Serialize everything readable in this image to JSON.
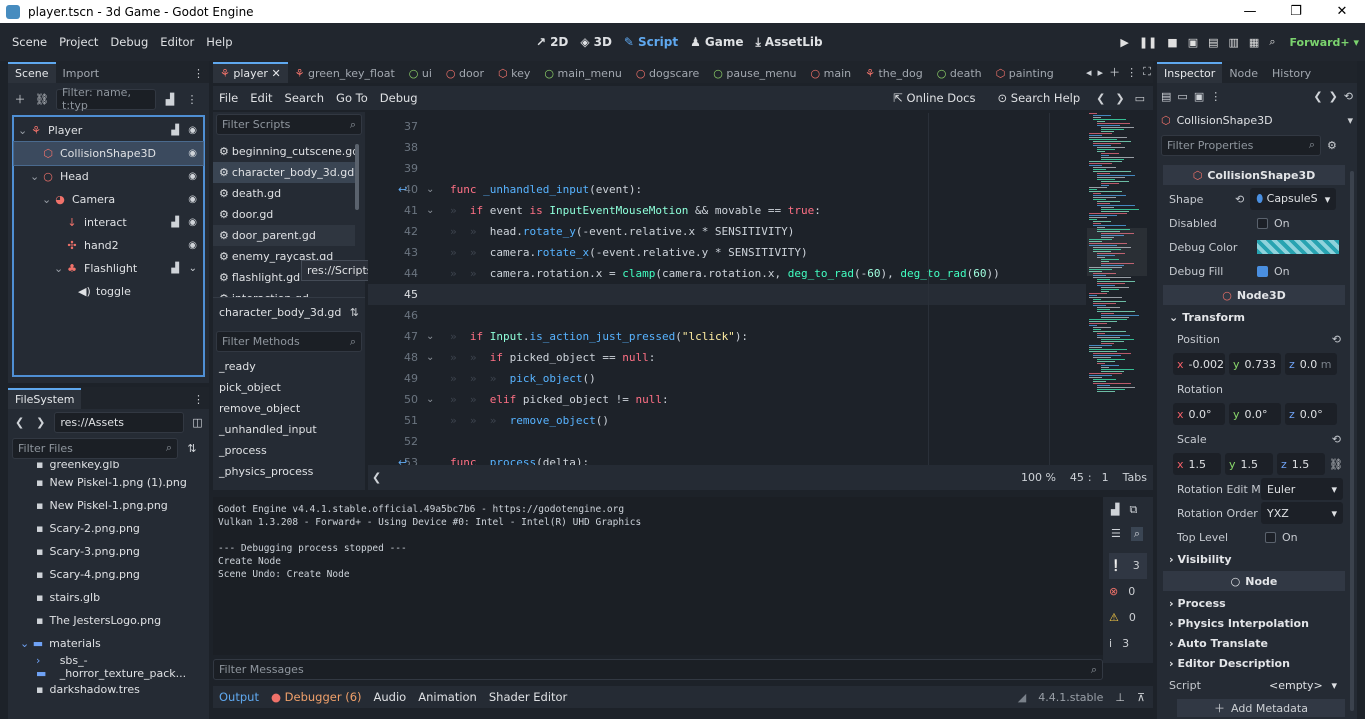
{
  "window": {
    "title": "player.tscn - 3d Game - Godot Engine",
    "min": "—",
    "max": "❐",
    "close": "✕"
  },
  "menu": {
    "items": [
      "Scene",
      "Project",
      "Debug",
      "Editor",
      "Help"
    ]
  },
  "workspaces": [
    {
      "label": "2D",
      "icon": "2d-icon"
    },
    {
      "label": "3D",
      "icon": "3d-icon"
    },
    {
      "label": "Script",
      "icon": "script-icon",
      "active": true
    },
    {
      "label": "Game",
      "icon": "game-icon"
    },
    {
      "label": "AssetLib",
      "icon": "assetlib-icon"
    }
  ],
  "renderer": "Forward+",
  "scene_panel": {
    "tabs": [
      "Scene",
      "Import"
    ],
    "filter_placeholder": "Filter: name, t:typ",
    "tree": [
      {
        "label": "Player",
        "indent": 0,
        "icon": "⚘",
        "color": "red",
        "script": true,
        "eye": true
      },
      {
        "label": "CollisionShape3D",
        "indent": 1,
        "icon": "⬡",
        "color": "red",
        "selected": true,
        "eye": true
      },
      {
        "label": "Head",
        "indent": 1,
        "icon": "○",
        "color": "red",
        "eye": true
      },
      {
        "label": "Camera",
        "indent": 2,
        "icon": "◕",
        "color": "red",
        "eye": true
      },
      {
        "label": "interact",
        "indent": 3,
        "icon": "↓",
        "color": "red",
        "script": true,
        "eye": true
      },
      {
        "label": "hand2",
        "indent": 3,
        "icon": "✣",
        "color": "red",
        "eye": true
      },
      {
        "label": "Flashlight",
        "indent": 3,
        "icon": "♣",
        "color": "red",
        "script": true,
        "eye": true
      },
      {
        "label": "toggle",
        "indent": 4,
        "icon": "◀)",
        "color": "white"
      }
    ]
  },
  "filesystem": {
    "title": "FileSystem",
    "path": "res://Assets",
    "filter_placeholder": "Filter Files",
    "items": [
      {
        "label": "greenkey.glb",
        "indent": 1,
        "partial": true
      },
      {
        "label": "New Piskel-1.png (1).png",
        "indent": 1
      },
      {
        "label": "New Piskel-1.png.png",
        "indent": 1
      },
      {
        "label": "Scary-2.png.png",
        "indent": 1
      },
      {
        "label": "Scary-3.png.png",
        "indent": 1
      },
      {
        "label": "Scary-4.png.png",
        "indent": 1
      },
      {
        "label": "stairs.glb",
        "indent": 1
      },
      {
        "label": "The JestersLogo.png",
        "indent": 1
      },
      {
        "label": "materials",
        "indent": 0,
        "folder": true
      },
      {
        "label": "sbs_-_horror_texture_pack...",
        "indent": 1,
        "folder": true
      },
      {
        "label": "darkshadow.tres",
        "indent": 1
      }
    ]
  },
  "script_tabs": [
    {
      "label": "player",
      "active": true
    },
    {
      "label": "green_key_float"
    },
    {
      "label": "ui"
    },
    {
      "label": "door"
    },
    {
      "label": "key"
    },
    {
      "label": "main_menu"
    },
    {
      "label": "dogscare"
    },
    {
      "label": "pause_menu"
    },
    {
      "label": "main"
    },
    {
      "label": "the_dog"
    },
    {
      "label": "death"
    },
    {
      "label": "painting"
    }
  ],
  "script_menu": {
    "items": [
      "File",
      "Edit",
      "Search",
      "Go To",
      "Debug"
    ],
    "online_docs": "Online Docs",
    "search_help": "Search Help"
  },
  "scripts_list": {
    "filter_placeholder": "Filter Scripts",
    "items": [
      "beginning_cutscene.gd",
      "character_body_3d.gd",
      "death.gd",
      "door.gd",
      "door_parent.gd",
      "enemy_raycast.gd",
      "flashlight.gd",
      "interaction.gd"
    ],
    "tooltip": "res://Scripts/door_parent.gd",
    "current": "character_body_3d.gd"
  },
  "methods": {
    "filter_placeholder": "Filter Methods",
    "items": [
      "_ready",
      "pick_object",
      "remove_object",
      "_unhandled_input",
      "_process",
      "_physics_process"
    ]
  },
  "editor": {
    "zoom": "100 %",
    "line": "45",
    "col": "1",
    "indent": "Tabs",
    "line_numbers": [
      "37",
      "38",
      "39",
      "40",
      "41",
      "42",
      "43",
      "44",
      "45",
      "46",
      "47",
      "48",
      "49",
      "50",
      "51",
      "52",
      "53"
    ]
  },
  "output": {
    "lines": [
      "Godot Engine v4.4.1.stable.official.49a5bc7b6 - https://godotengine.org",
      "Vulkan 1.3.208 - Forward+ - Using Device #0: Intel - Intel(R) UHD Graphics",
      "",
      "--- Debugging process stopped ---",
      "Create Node",
      "Scene Undo: Create Node"
    ],
    "filter_placeholder": "Filter Messages",
    "counts": [
      "3",
      "0",
      "0",
      "3"
    ]
  },
  "bottom_tabs": [
    "Output",
    "Debugger (6)",
    "Audio",
    "Animation",
    "Shader Editor"
  ],
  "version": "4.4.1.stable",
  "inspector": {
    "tabs": [
      "Inspector",
      "Node",
      "History"
    ],
    "node": "CollisionShape3D",
    "filter_placeholder": "Filter Properties",
    "section": "CollisionShape3D",
    "shape_label": "Shape",
    "shape_value": "CapsuleS",
    "disabled_label": "Disabled",
    "debug_color_label": "Debug Color",
    "debug_fill_label": "Debug Fill",
    "on": "On",
    "node3d": "Node3D",
    "transform": "Transform",
    "position_label": "Position",
    "position": {
      "x": "-0.002",
      "y": "0.733",
      "z": "0.0",
      "unit": "m"
    },
    "rotation_label": "Rotation",
    "rotation": {
      "x": "0.0",
      "y": "0.0",
      "z": "0.0",
      "unit": "°"
    },
    "scale_label": "Scale",
    "scale": {
      "x": "1.5",
      "y": "1.5",
      "z": "1.5"
    },
    "rotation_edit_label": "Rotation Edit M",
    "rotation_edit_value": "Euler",
    "rotation_order_label": "Rotation Order",
    "rotation_order_value": "YXZ",
    "top_level_label": "Top Level",
    "visibility": "Visibility",
    "node_section": "Node",
    "process": "Process",
    "physics_interp": "Physics Interpolation",
    "auto_translate": "Auto Translate",
    "editor_desc": "Editor Description",
    "script_label": "Script",
    "script_value": "<empty>",
    "add_metadata": "Add Metadata"
  }
}
